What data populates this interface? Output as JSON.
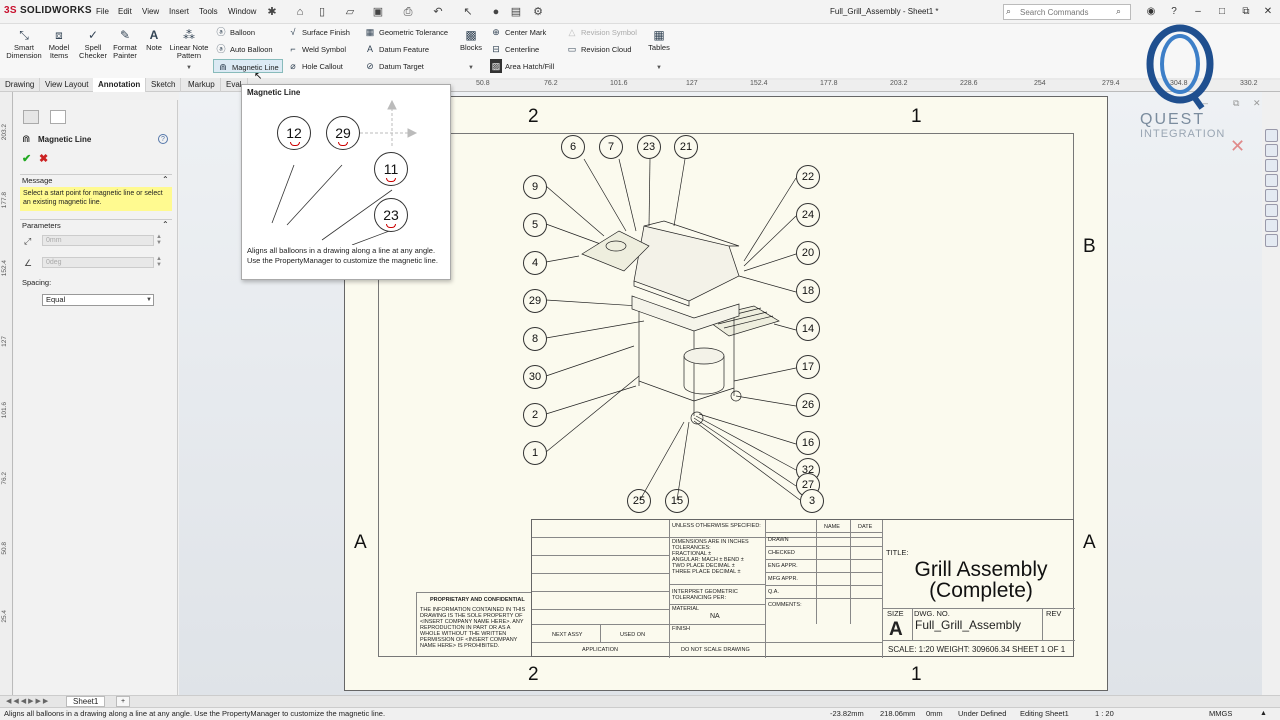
{
  "app": {
    "name_a": "3S",
    "name_b": "SOLIDWORKS",
    "doc_title": "Full_Grill_Assembly - Sheet1 *"
  },
  "menu": [
    "File",
    "Edit",
    "View",
    "Insert",
    "Tools",
    "Window"
  ],
  "search": {
    "placeholder": "Search Commands"
  },
  "ribbon": {
    "big": [
      {
        "label": "Smart\nDimension"
      },
      {
        "label": "Model\nItems"
      },
      {
        "label": "Spell\nChecker"
      },
      {
        "label": "Format\nPainter"
      },
      {
        "label": "Note"
      },
      {
        "label": "Linear Note\nPattern"
      },
      {
        "label": "Blocks"
      },
      {
        "label": "Tables"
      }
    ],
    "col1": [
      "Balloon",
      "Auto Balloon",
      "Magnetic Line"
    ],
    "col2": [
      "Surface Finish",
      "Weld Symbol",
      "Hole Callout"
    ],
    "col3": [
      "Geometric Tolerance",
      "Datum Feature",
      "Datum Target"
    ],
    "col4": [
      "Center Mark",
      "Centerline",
      "Area Hatch/Fill"
    ],
    "col5": [
      "Revision Symbol",
      "Revision Cloud"
    ]
  },
  "tabs": [
    "Drawing",
    "View Layout",
    "Annotation",
    "Sketch",
    "Markup",
    "Eval"
  ],
  "ruler_top": [
    "50.8",
    "76.2",
    "101.6",
    "127",
    "152.4",
    "177.8",
    "203.2",
    "228.6",
    "254",
    "279.4",
    "304.8",
    "330.2"
  ],
  "ruler_left": [
    "203.2",
    "177.8",
    "152.4",
    "127",
    "101.6",
    "76.2",
    "50.8",
    "25.4"
  ],
  "pm": {
    "title": "Magnetic Line",
    "message_title": "Message",
    "message": "Select a start point for magnetic line or select an existing magnetic line.",
    "params_title": "Parameters",
    "length": "0mm",
    "angle": "0deg",
    "spacing_label": "Spacing:",
    "spacing_value": "Equal"
  },
  "tooltip": {
    "title": "Magnetic Line",
    "balloons": [
      "12",
      "29",
      "11",
      "23"
    ],
    "desc": "Aligns all balloons in a drawing along a line at any angle. Use the PropertyManager to customize the magnetic line."
  },
  "sheet": {
    "zones_top": [
      "2",
      "1"
    ],
    "zones_bottom": [
      "2",
      "1"
    ],
    "zones_side_left": [
      "A"
    ],
    "zones_side_right": [
      "B",
      "A"
    ],
    "balloons": [
      "6",
      "7",
      "23",
      "21",
      "9",
      "5",
      "4",
      "29",
      "8",
      "30",
      "2",
      "1",
      "22",
      "24",
      "20",
      "18",
      "14",
      "17",
      "26",
      "16",
      "32",
      "27",
      "3",
      "25",
      "15"
    ]
  },
  "titleblock": {
    "unless": "UNLESS OTHERWISE SPECIFIED:",
    "name": "NAME",
    "date": "DATE",
    "dims": "DIMENSIONS ARE IN INCHES\nTOLERANCES:\nFRACTIONAL ±\nANGULAR: MACH ±   BEND ±\nTWO PLACE DECIMAL   ±\nTHREE PLACE DECIMAL  ±",
    "drawn": "DRAWN",
    "checked": "CHECKED",
    "eng": "ENG APPR.",
    "mfg": "MFG APPR.",
    "qa": "Q.A.",
    "comments": "COMMENTS:",
    "interpret": "INTERPRET GEOMETRIC\nTOLERANCING PER:",
    "material": "MATERIAL",
    "material_val": "NA",
    "finish": "FINISH",
    "next_assy": "NEXT ASSY",
    "used_on": "USED ON",
    "application": "APPLICATION",
    "do_not_scale": "DO NOT SCALE DRAWING",
    "prop_title": "PROPRIETARY AND CONFIDENTIAL",
    "prop_text": "THE INFORMATION CONTAINED IN THIS DRAWING IS THE SOLE PROPERTY OF <INSERT COMPANY NAME HERE>. ANY REPRODUCTION IN PART OR AS A WHOLE WITHOUT THE WRITTEN PERMISSION OF <INSERT COMPANY NAME HERE> IS PROHIBITED.",
    "title_label": "TITLE:",
    "title_1": "Grill Assembly",
    "title_2": "(Complete)",
    "size_label": "SIZE",
    "size": "A",
    "dwg_label": "DWG.  NO.",
    "dwg": "Full_Grill_Assembly",
    "rev": "REV",
    "scale": "SCALE: 1:20 WEIGHT: 309606.34",
    "sheet": "SHEET 1 OF 1"
  },
  "watermark": {
    "line1": "QUEST",
    "line2": "INTEGRATION"
  },
  "bottom_tab": "Sheet1",
  "status": {
    "hint": "Aligns all balloons in a drawing along a line at any angle. Use the PropertyManager to customize the magnetic line.",
    "x": "-23.82mm",
    "y": "218.06mm",
    "z": "0mm",
    "state": "Under Defined",
    "editing": "Editing Sheet1",
    "scale": "1 : 20",
    "units": "MMGS"
  }
}
